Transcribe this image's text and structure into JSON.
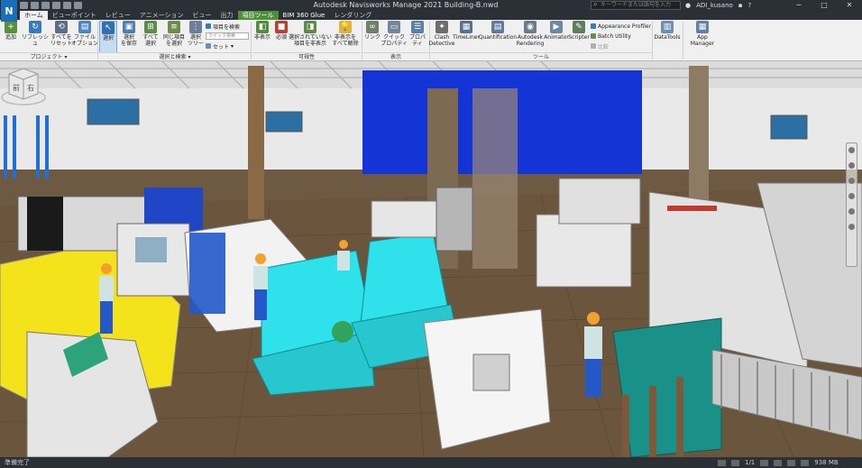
{
  "window": {
    "title": "Autodesk Navisworks Manage 2021   Building-B.nwd",
    "search_placeholder": "キーワードまたは語句を入力",
    "user": "ADI_kusano",
    "logo": "N"
  },
  "tabs": [
    "ホーム",
    "ビューポイント",
    "レビュー",
    "アニメーション",
    "ビュー",
    "出力",
    "項目ツール",
    "BIM 360 Glue",
    "レンダリング"
  ],
  "ribbon": {
    "project": {
      "append": "追加",
      "refresh": "リフレッシュ",
      "reset_all": "すべてを\nリセット",
      "file_options": "ファイル\nオプション",
      "label": "プロジェクト ▾"
    },
    "select_search": {
      "select": "選択",
      "save_selection": "選択\nを保存",
      "select_all": "すべて\n選択",
      "select_same": "同じ項目\nを選択",
      "selection_tree": "選択\nツリー",
      "find_items": "項目を検索",
      "quick_find_placeholder": "クイック検索",
      "sets": "セット",
      "label": "選択と検索 ▾"
    },
    "visibility": {
      "hide": "非表示",
      "require": "必須",
      "hide_unselected": "選択されていない\n項目を非表示",
      "unhide_all": "非表示を\nすべて解除",
      "label": "可視性"
    },
    "display": {
      "links": "リンク",
      "quick_properties": "クイック\nプロパティ",
      "properties": "プロパティ",
      "label": "表示"
    },
    "tools": {
      "clash_detective": "Clash\nDetective",
      "timeliner": "TimeLiner",
      "quantification": "Quantification",
      "autodesk_rendering": "Autodesk\nRendering",
      "animator": "Animator",
      "scripter": "Scripter",
      "appearance_profiler": "Appearance Profiler",
      "batch_utility": "Batch Utility",
      "compare": "比較",
      "label": "ツール"
    },
    "datatools": "DataTools",
    "app_manager": "App Manager"
  },
  "viewcube": {
    "left": "前",
    "right": "右"
  },
  "status": {
    "text": "準備完了",
    "page": "1/1",
    "memory": "938 MB"
  },
  "colors": {
    "titlebar": "#2b2f36",
    "ribbon": "#f0f0f0",
    "tool_tab": "#4e8f3a",
    "floor": "#6e5a43",
    "accent_blue": "#1a6fb8"
  },
  "icons": [
    "append-icon",
    "refresh-icon",
    "reset-icon",
    "file-options-icon",
    "select-icon",
    "save-selection-icon",
    "select-all-icon",
    "select-same-icon",
    "selection-tree-icon",
    "hide-icon",
    "require-icon",
    "hide-unselected-icon",
    "unhide-all-icon",
    "links-icon",
    "quick-properties-icon",
    "properties-icon",
    "clash-detective-icon",
    "timeliner-icon",
    "quantification-icon",
    "rendering-icon",
    "animator-icon",
    "scripter-icon",
    "datatools-icon",
    "app-manager-icon"
  ]
}
